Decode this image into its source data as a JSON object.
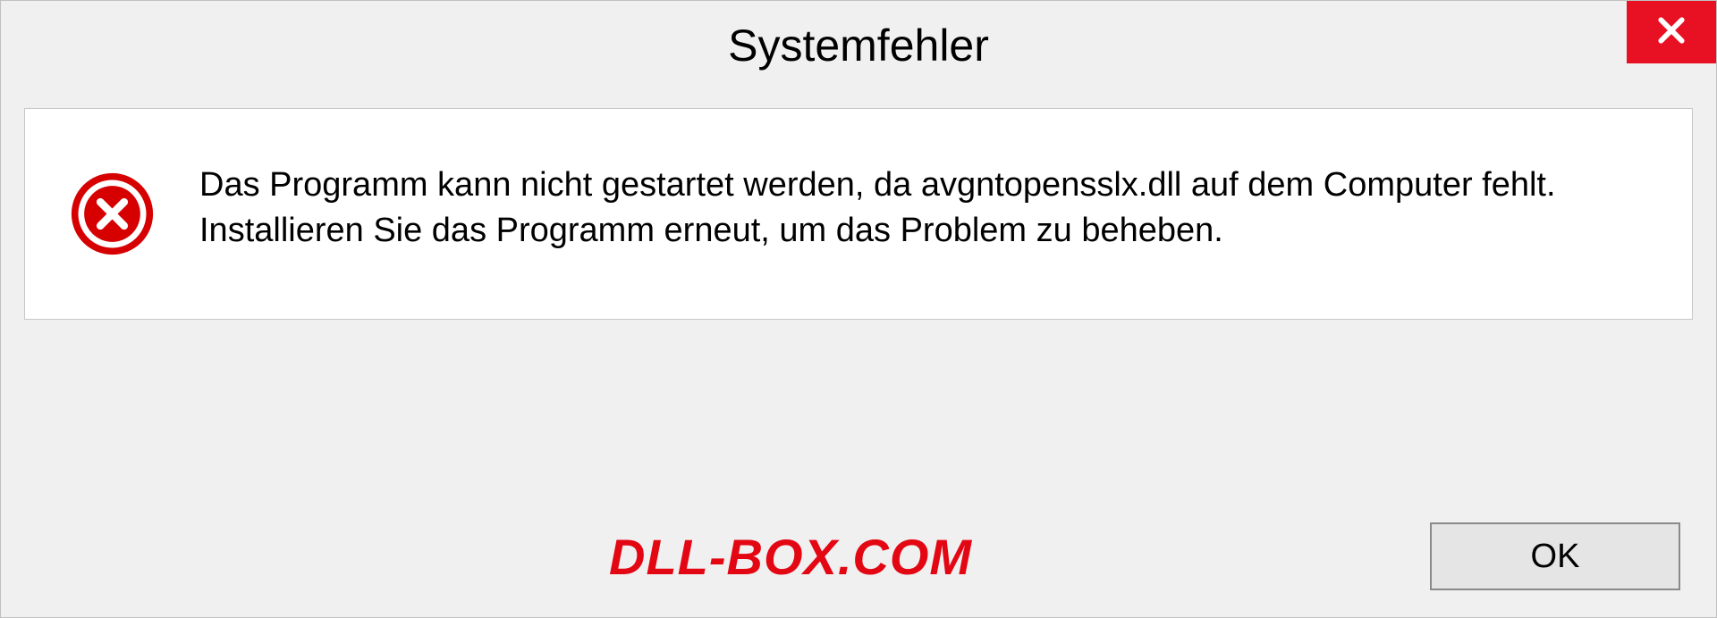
{
  "dialog": {
    "title": "Systemfehler",
    "message": "Das Programm kann nicht gestartet werden, da avgntopensslx.dll auf dem Computer fehlt. Installieren Sie das Programm erneut, um das Problem zu beheben.",
    "ok_label": "OK"
  },
  "watermark": "DLL-BOX.COM",
  "colors": {
    "close_bg": "#e81123",
    "error_icon": "#d60000",
    "watermark": "#e30613"
  }
}
